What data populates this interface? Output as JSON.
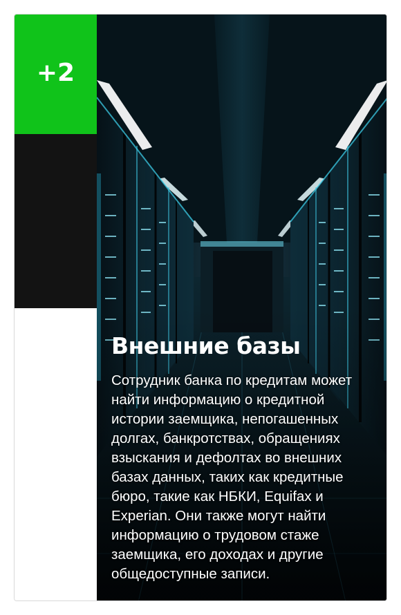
{
  "card": {
    "badge": "+2",
    "title": "Внешние базы",
    "description": "Сотрудник банка по кредитам может найти информацию о кредитной истории заемщика, непогашенных долгах, банкротствах, обращениях взыскания и дефолтах во внешних базах данных, таких как кредитные бюро, такие как НБКИ, Equifax и Experian. Они также могут найти информацию о трудовом стаже заемщика, его доходах и другие общедоступные записи."
  },
  "colors": {
    "badge_bg": "#10c31a",
    "dark_block": "#131313",
    "text": "#ffffff"
  }
}
